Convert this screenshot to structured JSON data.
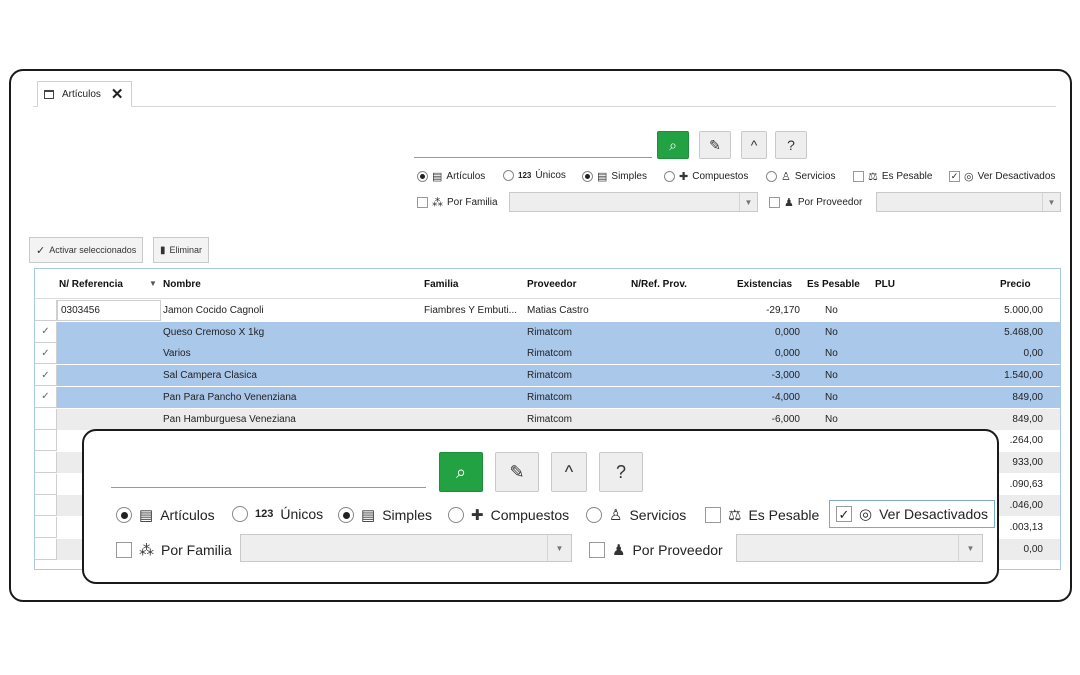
{
  "tab": {
    "label": "Artículos",
    "icon": "archive-icon",
    "close": "✕"
  },
  "toolbar": {
    "search": "⌕",
    "clear": "✎",
    "up": "^",
    "help": "?"
  },
  "options": {
    "articulos": "Artículos",
    "unicos_num": "123",
    "unicos": "Únicos",
    "simples": "Simples",
    "compuestos": "Compuestos",
    "servicios": "Servicios",
    "es_pesable": "Es Pesable",
    "ver_desactivados": "Ver Desactivados",
    "por_familia": "Por Familia",
    "por_proveedor": "Por Proveedor"
  },
  "actions": {
    "activar": "Activar seleccionados",
    "eliminar": "Eliminar"
  },
  "columns": [
    "N/ Referencia",
    "Nombre",
    "Familia",
    "Proveedor",
    "N/Ref. Prov.",
    "Existencias",
    "Es Pesable",
    "PLU",
    "Precio"
  ],
  "rows": [
    {
      "check": "",
      "ref": "0303456",
      "nombre": "Jamon Cocido Cagnoli",
      "familia": "Fiambres Y Embuti...",
      "proveedor": "Matias Castro",
      "existencias": "-29,170",
      "pesable": "No",
      "precio": "5.000,00",
      "style": "plain"
    },
    {
      "check": "✓",
      "ref": "",
      "nombre": "Queso Cremoso X 1kg",
      "familia": "",
      "proveedor": "Rimatcom",
      "existencias": "0,000",
      "pesable": "No",
      "precio": "5.468,00",
      "style": "sel"
    },
    {
      "check": "✓",
      "ref": "",
      "nombre": "Varios",
      "familia": "",
      "proveedor": "Rimatcom",
      "existencias": "0,000",
      "pesable": "No",
      "precio": "0,00",
      "style": "sel"
    },
    {
      "check": "✓",
      "ref": "",
      "nombre": "Sal Campera Clasica",
      "familia": "",
      "proveedor": "Rimatcom",
      "existencias": "-3,000",
      "pesable": "No",
      "precio": "1.540,00",
      "style": "sel"
    },
    {
      "check": "✓",
      "ref": "",
      "nombre": "Pan Para Pancho Venenziana",
      "familia": "",
      "proveedor": "Rimatcom",
      "existencias": "-4,000",
      "pesable": "No",
      "precio": "849,00",
      "style": "sel"
    },
    {
      "check": "",
      "ref": "",
      "nombre": "Pan Hamburguesa Veneziana",
      "familia": "",
      "proveedor": "Rimatcom",
      "existencias": "-6,000",
      "pesable": "No",
      "precio": "849,00",
      "style": "gray"
    },
    {
      "check": "",
      "ref": "",
      "nombre": "",
      "familia": "",
      "proveedor": "",
      "existencias": "",
      "pesable": "",
      "precio": ".264,00",
      "style": "plain"
    },
    {
      "check": "",
      "ref": "",
      "nombre": "",
      "familia": "",
      "proveedor": "",
      "existencias": "",
      "pesable": "",
      "precio": "933,00",
      "style": "gray"
    },
    {
      "check": "",
      "ref": "",
      "nombre": "",
      "familia": "",
      "proveedor": "",
      "existencias": "",
      "pesable": "",
      "precio": ".090,63",
      "style": "plain"
    },
    {
      "check": "",
      "ref": "",
      "nombre": "",
      "familia": "",
      "proveedor": "",
      "existencias": "",
      "pesable": "",
      "precio": ".046,00",
      "style": "gray"
    },
    {
      "check": "",
      "ref": "",
      "nombre": "",
      "familia": "",
      "proveedor": "",
      "existencias": "",
      "pesable": "",
      "precio": ".003,13",
      "style": "plain"
    },
    {
      "check": "",
      "ref": "",
      "nombre": "",
      "familia": "",
      "proveedor": "",
      "existencias": "",
      "pesable": "",
      "precio": "0,00",
      "style": "gray"
    }
  ],
  "colors": {
    "accent_green": "#23a243",
    "selection": "#a9c8ea",
    "border": "#1a1a1a"
  }
}
